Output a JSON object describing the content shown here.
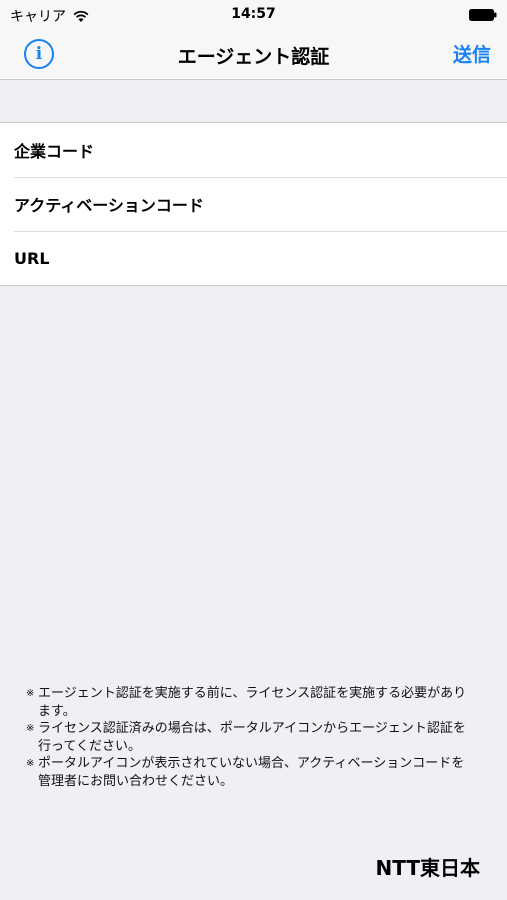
{
  "status_bar": {
    "carrier": "キャリア",
    "time": "14:57",
    "wifi_icon": "wifi-icon",
    "battery_icon": "battery-icon"
  },
  "nav": {
    "info_icon": "info-icon",
    "info_glyph": "i",
    "title": "エージェント認証",
    "send_label": "送信"
  },
  "form": {
    "rows": [
      {
        "label": "企業コード"
      },
      {
        "label": "アクティベーションコード"
      },
      {
        "label": "URL"
      }
    ]
  },
  "notes": {
    "mark": "※",
    "lines": [
      "エージェント認証を実施する前に、ライセンス認証を実施する必要があります。",
      "ライセンス認証済みの場合は、ポータルアイコンからエージェント認証を行ってください。",
      "ポータルアイコンが表示されていない場合、アクティベーションコードを管理者にお問い合わせください。"
    ]
  },
  "logo": {
    "text": "NTT東日本"
  },
  "colors": {
    "accent": "#1a82f0",
    "background": "#efeff4",
    "cell": "#ffffff"
  }
}
